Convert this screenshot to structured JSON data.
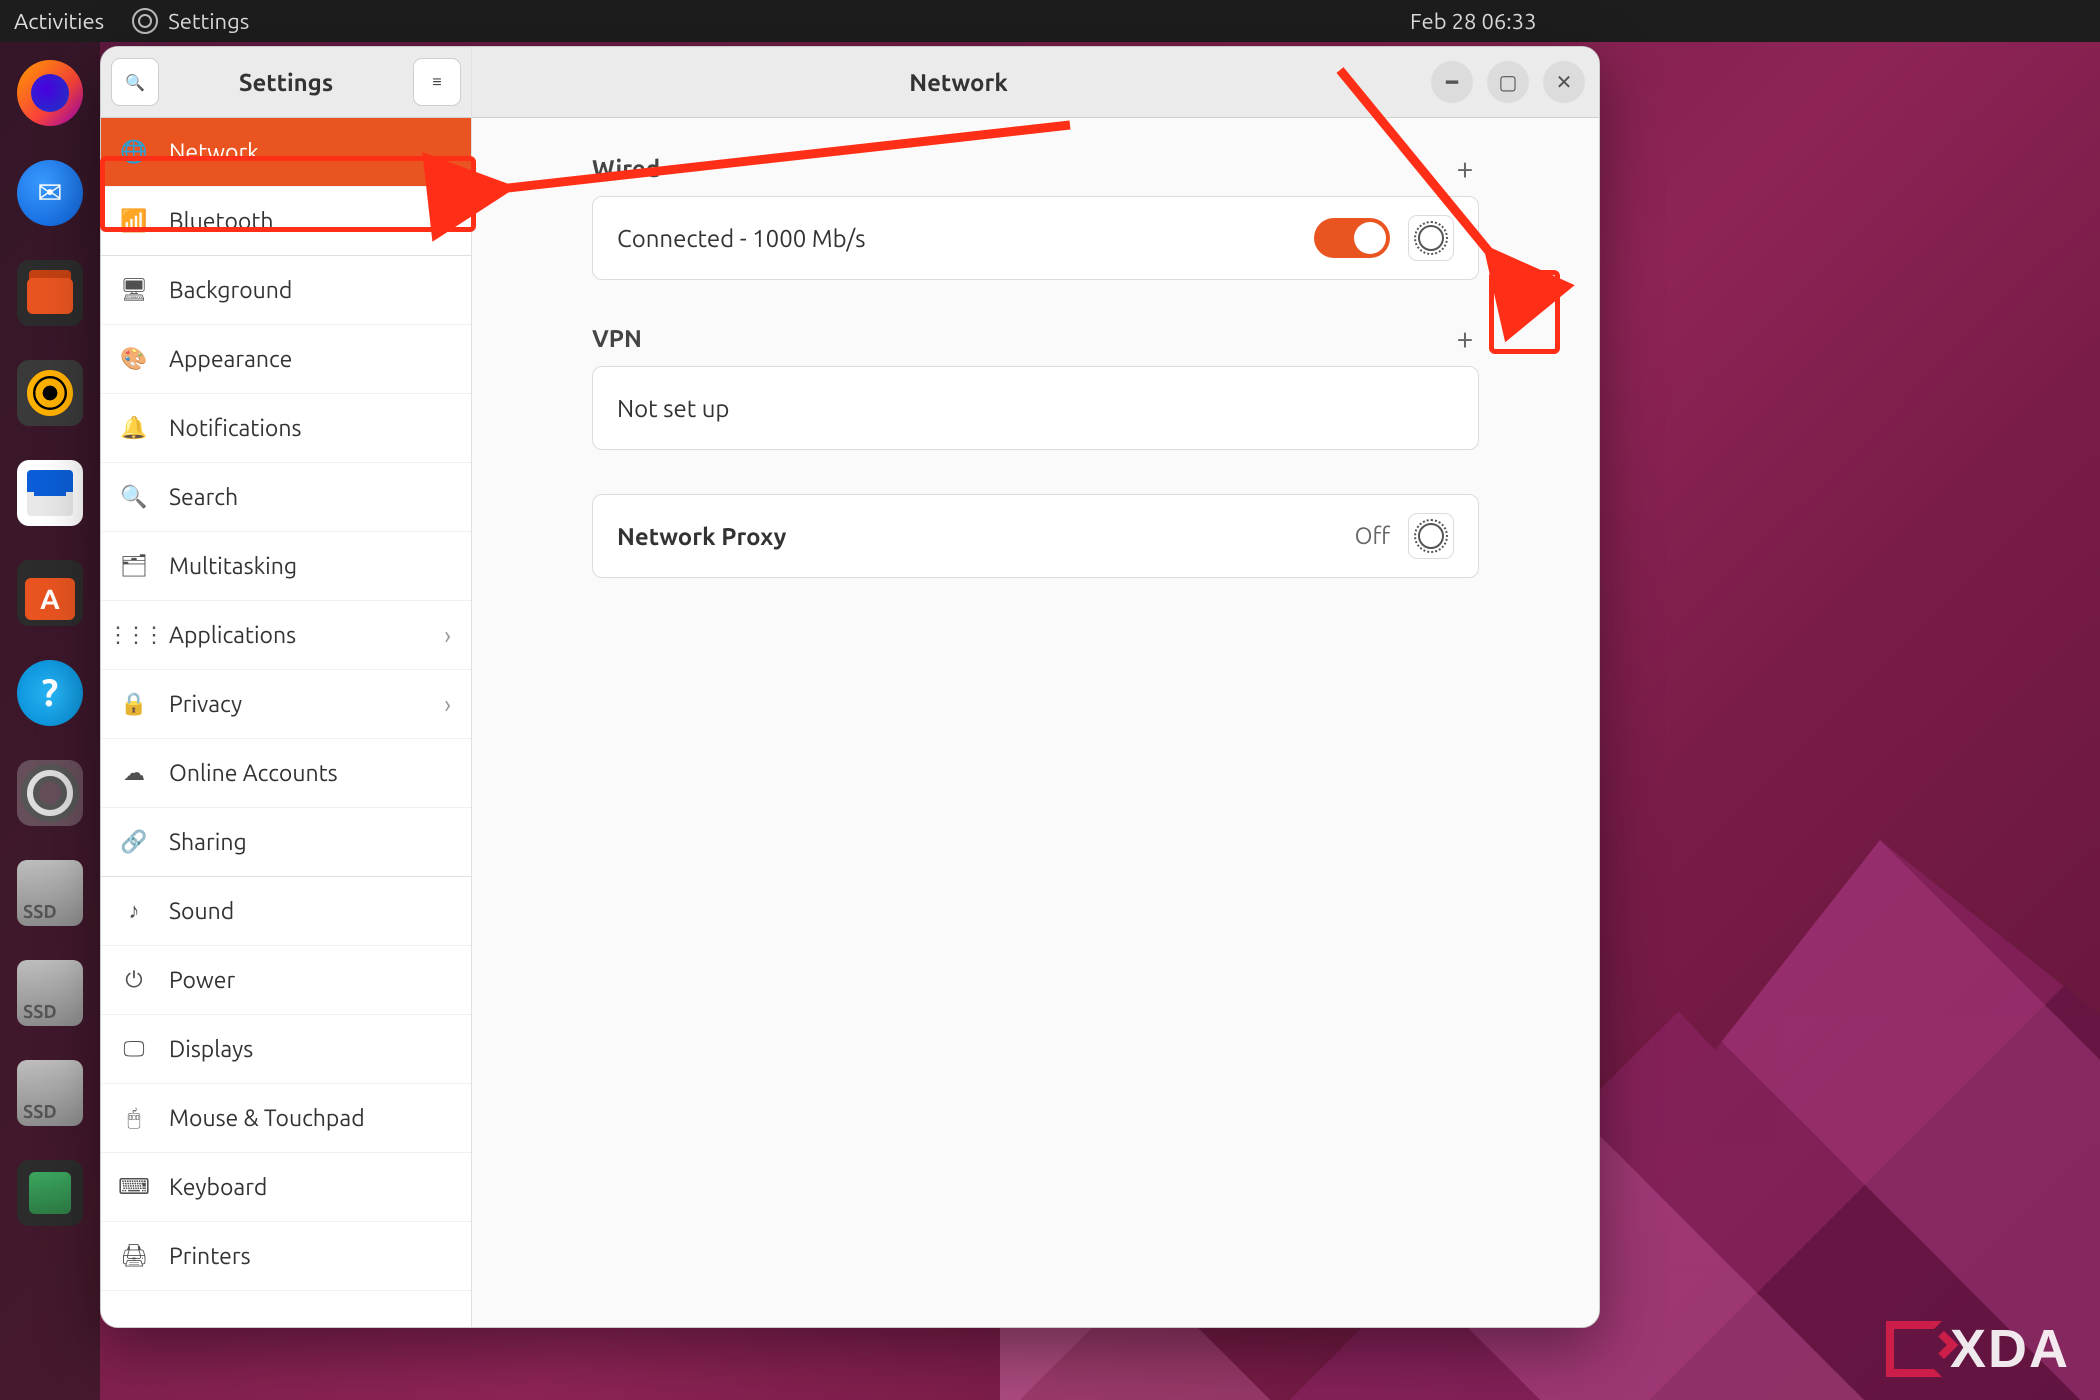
{
  "topbar": {
    "activities": "Activities",
    "app": "Settings",
    "datetime": "Feb 28  06:33"
  },
  "dock": [
    {
      "name": "firefox"
    },
    {
      "name": "thunderbird"
    },
    {
      "name": "files"
    },
    {
      "name": "rhythmbox"
    },
    {
      "name": "libreoffice-writer"
    },
    {
      "name": "ubuntu-software"
    },
    {
      "name": "help"
    },
    {
      "name": "settings",
      "active": true
    },
    {
      "name": "ssd-1"
    },
    {
      "name": "ssd-2"
    },
    {
      "name": "ssd-3"
    },
    {
      "name": "trash"
    }
  ],
  "window": {
    "sidebar_title": "Settings",
    "main_title": "Network",
    "items": [
      {
        "key": "network",
        "label": "Network",
        "icon": "g-globe",
        "selected": true
      },
      {
        "key": "bluetooth",
        "label": "Bluetooth",
        "icon": "g-bt",
        "group_end": true
      },
      {
        "key": "background",
        "label": "Background",
        "icon": "g-bg"
      },
      {
        "key": "appearance",
        "label": "Appearance",
        "icon": "g-app"
      },
      {
        "key": "notifications",
        "label": "Notifications",
        "icon": "g-bell"
      },
      {
        "key": "search",
        "label": "Search",
        "icon": "g-search"
      },
      {
        "key": "multitasking",
        "label": "Multitasking",
        "icon": "g-multi"
      },
      {
        "key": "applications",
        "label": "Applications",
        "icon": "g-apps",
        "chevron": true
      },
      {
        "key": "privacy",
        "label": "Privacy",
        "icon": "g-lock",
        "chevron": true
      },
      {
        "key": "online-accounts",
        "label": "Online Accounts",
        "icon": "g-cloud"
      },
      {
        "key": "sharing",
        "label": "Sharing",
        "icon": "g-share",
        "group_end": true
      },
      {
        "key": "sound",
        "label": "Sound",
        "icon": "g-sound"
      },
      {
        "key": "power",
        "label": "Power",
        "icon": "g-power"
      },
      {
        "key": "displays",
        "label": "Displays",
        "icon": "g-disp"
      },
      {
        "key": "mouse-touchpad",
        "label": "Mouse & Touchpad",
        "icon": "g-mouse"
      },
      {
        "key": "keyboard",
        "label": "Keyboard",
        "icon": "g-kb"
      },
      {
        "key": "printers",
        "label": "Printers",
        "icon": "g-print"
      }
    ]
  },
  "network": {
    "wired": {
      "heading": "Wired",
      "status": "Connected - 1000 Mb/s",
      "enabled": true
    },
    "vpn": {
      "heading": "VPN",
      "status": "Not set up"
    },
    "proxy": {
      "label": "Network Proxy",
      "value": "Off"
    }
  },
  "watermark": "XDA",
  "colors": {
    "accent": "#e95420",
    "highlight": "#ff2e17"
  }
}
